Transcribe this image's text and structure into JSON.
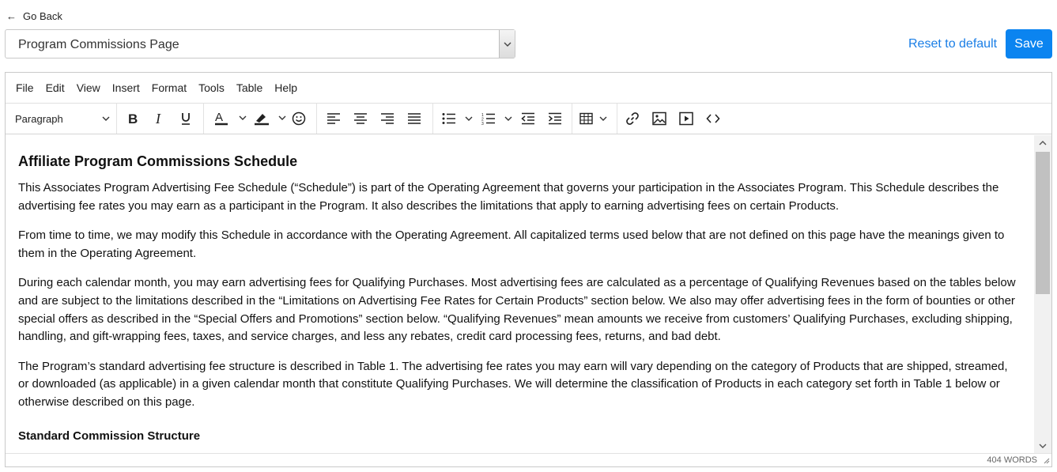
{
  "nav": {
    "back_label": "Go Back"
  },
  "page_select": {
    "value": "Program Commissions Page"
  },
  "actions": {
    "reset_label": "Reset to default",
    "save_label": "Save"
  },
  "editor": {
    "menu": [
      "File",
      "Edit",
      "View",
      "Insert",
      "Format",
      "Tools",
      "Table",
      "Help"
    ],
    "block_format": "Paragraph",
    "toolbar_icons": [
      "bold-icon",
      "italic-icon",
      "underline-icon",
      "text-color-icon",
      "highlight-color-icon",
      "emoji-icon",
      "align-left-icon",
      "align-center-icon",
      "align-right-icon",
      "align-justify-icon",
      "bullet-list-icon",
      "numbered-list-icon",
      "outdent-icon",
      "indent-icon",
      "table-icon",
      "link-icon",
      "image-icon",
      "media-icon",
      "source-code-icon"
    ],
    "content": {
      "heading": "Affiliate Program Commissions Schedule",
      "paragraphs": [
        "This Associates Program Advertising Fee Schedule (“Schedule”) is part of the Operating Agreement that governs your participation in the Associates Program. This Schedule describes the advertising fee rates you may earn as a participant in the Program. It also describes the limitations that apply to earning advertising fees on certain Products.",
        "From time to time, we may modify this Schedule in accordance with the Operating Agreement. All capitalized terms used below that are not defined on this page have the meanings given to them in the Operating Agreement.",
        "During each calendar month, you may earn advertising fees for Qualifying Purchases. Most advertising fees are calculated as a percentage of Qualifying Revenues based on the tables below and are subject to the limitations described in the “Limitations on Advertising Fee Rates for Certain Products” section below. We also may offer advertising fees in the form of bounties or other special offers as described in the “Special Offers and Promotions” section below. “Qualifying Revenues” mean amounts we receive from customers’ Qualifying Purchases, excluding shipping, handling, and gift-wrapping fees, taxes, and service charges, and less any rebates, credit card processing fees, returns, and bad debt.",
        "The Program’s standard advertising fee structure is described in Table 1. The advertising fee rates you may earn will vary depending on the category of Products that are shipped, streamed, or downloaded (as applicable) in a given calendar month that constitute Qualifying Purchases. We will determine the classification of Products in each category set forth in Table 1 below or otherwise described on this page."
      ],
      "subheading": "Standard Commission Structure"
    },
    "word_count": "404 WORDS"
  },
  "colors": {
    "accent": "#0b84f0",
    "link": "#1a7ee6"
  }
}
